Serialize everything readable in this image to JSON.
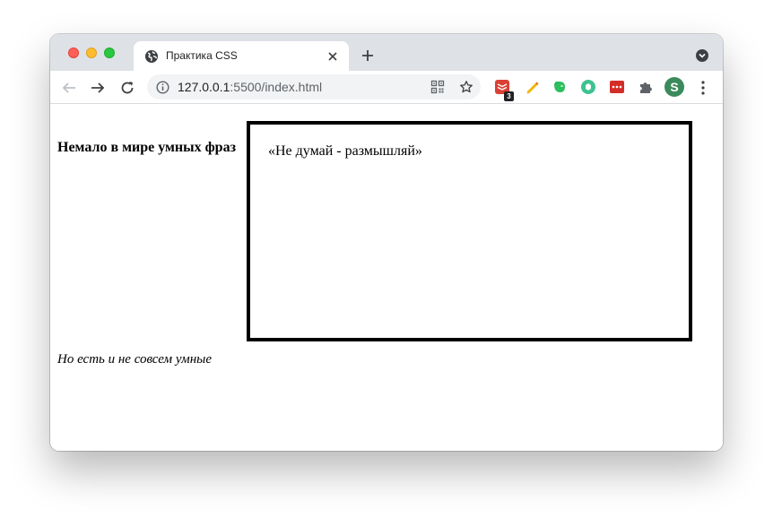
{
  "browser": {
    "tab": {
      "title": "Практика CSS"
    },
    "address": {
      "host": "127.0.0.1",
      "rest": ":5500/index.html"
    },
    "extensions": {
      "todoist_badge": "3"
    },
    "profile_initial": "S"
  },
  "page": {
    "heading": "Немало в мире умных фраз",
    "quote": "«Не думай - размышляй»",
    "italic_text": "Но есть и не совсем умные"
  },
  "colors": {
    "tabstrip": "#dee1e6",
    "omnibox": "#f1f3f4",
    "profile": "#3b8a5c",
    "todoist": "#db4035",
    "evernote": "#2dbe60",
    "lastpass": "#d32d27"
  }
}
